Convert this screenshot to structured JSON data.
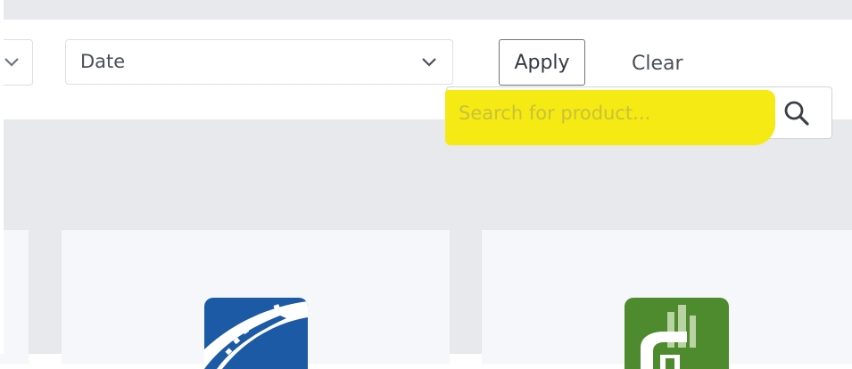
{
  "filters": {
    "date_select_value": "Date",
    "apply_label": "Apply",
    "clear_label": "Clear"
  },
  "search": {
    "placeholder": "Search for product..."
  },
  "icons": {
    "dropdown_chevron": "chevron-down-icon",
    "search": "search-icon"
  },
  "colors": {
    "highlight": "#f5ea14",
    "content_background": "#e7e9ec",
    "road_logo_blue": "#1c5aa5",
    "eco_logo_green": "#4e8a2e"
  }
}
